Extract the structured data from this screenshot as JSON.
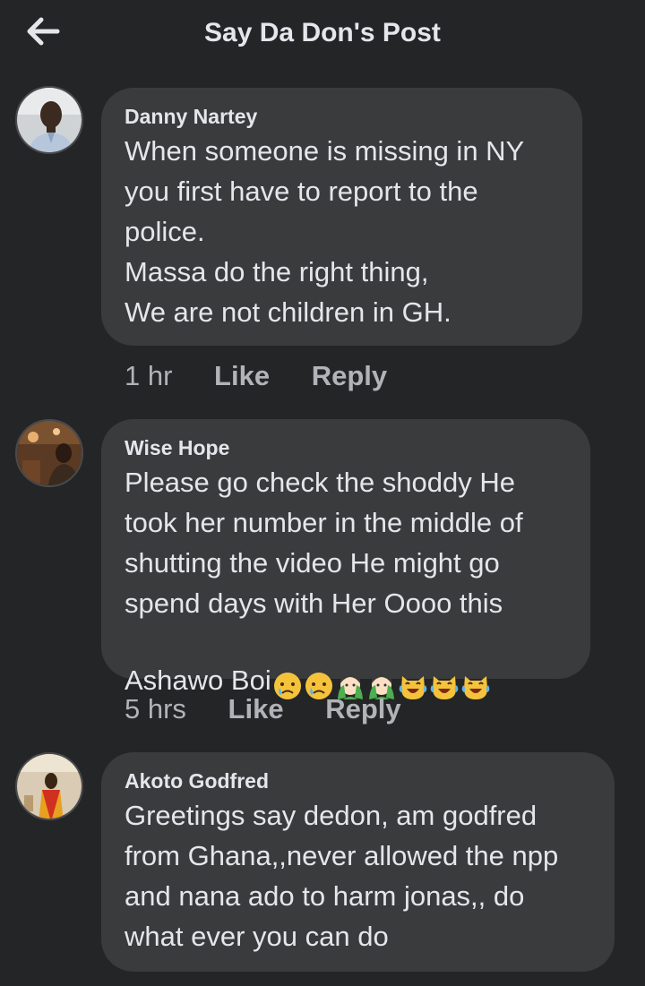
{
  "header": {
    "title": "Say Da Don's Post",
    "back_icon": "arrow-left-icon"
  },
  "colors": {
    "background": "#242526",
    "bubble": "#3a3b3c",
    "text": "#e4e6eb",
    "secondary": "#b0b3b8"
  },
  "comments": [
    {
      "author": "Danny Nartey",
      "text": "When someone is missing in NY\nyou first have to report to the\npolice.\nMassa do the right thing,\nWe are not children in GH.",
      "time": "1 hr",
      "like_label": "Like",
      "reply_label": "Reply"
    },
    {
      "author": "Wise Hope",
      "text": "Please go check the shoddy He\ntook her number in the middle of\nshutting the video He might go\nspend days with Her Oooo this\nAshawo Boi",
      "emojis": [
        "crying-face-emoji",
        "crying-face-emoji",
        "facepalm-emoji",
        "facepalm-emoji",
        "cat-tears-of-joy-emoji",
        "cat-tears-of-joy-emoji",
        "cat-tears-of-joy-emoji"
      ],
      "time": "5 hrs",
      "like_label": "Like",
      "reply_label": "Reply"
    },
    {
      "author": "Akoto Godfred",
      "text": "Greetings say dedon, am godfred\nfrom Ghana,,never allowed the npp\nand nana ado to harm jonas,, do\nwhat ever you can do"
    }
  ]
}
